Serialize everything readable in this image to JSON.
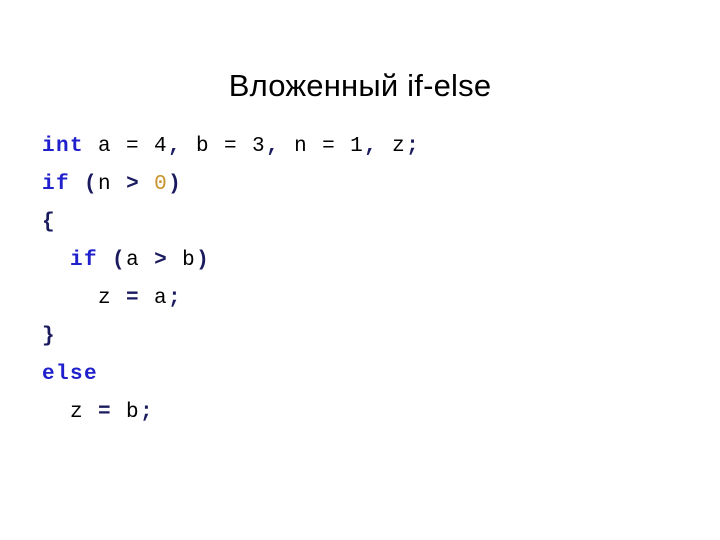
{
  "slide": {
    "title": "Вложенный if-else",
    "background_color": "#ffffff",
    "title_color": "#000000"
  },
  "colors": {
    "keyword": "#2020CC",
    "punctuation": "#1A1A5E",
    "number": "#C8922B",
    "plain": "#000000"
  },
  "code": {
    "language": "c",
    "lines": [
      {
        "id": "line-1",
        "text": "int a = 4, b = 3, n = 1, z;",
        "tokens": [
          {
            "t": "int",
            "k": "keyword"
          },
          {
            "t": " a = 4",
            "k": "plain"
          },
          {
            "t": ",",
            "k": "punct"
          },
          {
            "t": " b = 3",
            "k": "plain"
          },
          {
            "t": ",",
            "k": "punct"
          },
          {
            "t": " n = 1",
            "k": "plain"
          },
          {
            "t": ",",
            "k": "punct"
          },
          {
            "t": " z",
            "k": "plain"
          },
          {
            "t": ";",
            "k": "punct"
          }
        ]
      },
      {
        "id": "line-2",
        "text": "if (n > 0)",
        "tokens": [
          {
            "t": "if",
            "k": "keyword"
          },
          {
            "t": " ",
            "k": "plain"
          },
          {
            "t": "(",
            "k": "punct"
          },
          {
            "t": "n ",
            "k": "plain"
          },
          {
            "t": ">",
            "k": "punct"
          },
          {
            "t": " ",
            "k": "plain"
          },
          {
            "t": "0",
            "k": "number"
          },
          {
            "t": ")",
            "k": "punct"
          }
        ]
      },
      {
        "id": "line-3",
        "text": "{",
        "tokens": [
          {
            "t": "{",
            "k": "punct"
          }
        ]
      },
      {
        "id": "line-4",
        "text": "  if (a > b)",
        "tokens": [
          {
            "t": "  ",
            "k": "plain"
          },
          {
            "t": "if",
            "k": "keyword"
          },
          {
            "t": " ",
            "k": "plain"
          },
          {
            "t": "(",
            "k": "punct"
          },
          {
            "t": "a ",
            "k": "plain"
          },
          {
            "t": ">",
            "k": "punct"
          },
          {
            "t": " b",
            "k": "plain"
          },
          {
            "t": ")",
            "k": "punct"
          }
        ]
      },
      {
        "id": "line-5",
        "text": "    z = a;",
        "tokens": [
          {
            "t": "    z ",
            "k": "plain"
          },
          {
            "t": "=",
            "k": "punct"
          },
          {
            "t": " a",
            "k": "plain"
          },
          {
            "t": ";",
            "k": "punct"
          }
        ]
      },
      {
        "id": "line-6",
        "text": "}",
        "tokens": [
          {
            "t": "}",
            "k": "punct"
          }
        ]
      },
      {
        "id": "line-7",
        "text": "else",
        "tokens": [
          {
            "t": "else",
            "k": "keyword"
          }
        ]
      },
      {
        "id": "line-8",
        "text": "  z = b;",
        "tokens": [
          {
            "t": "  z ",
            "k": "plain"
          },
          {
            "t": "=",
            "k": "punct"
          },
          {
            "t": " b",
            "k": "plain"
          },
          {
            "t": ";",
            "k": "punct"
          }
        ]
      }
    ]
  }
}
